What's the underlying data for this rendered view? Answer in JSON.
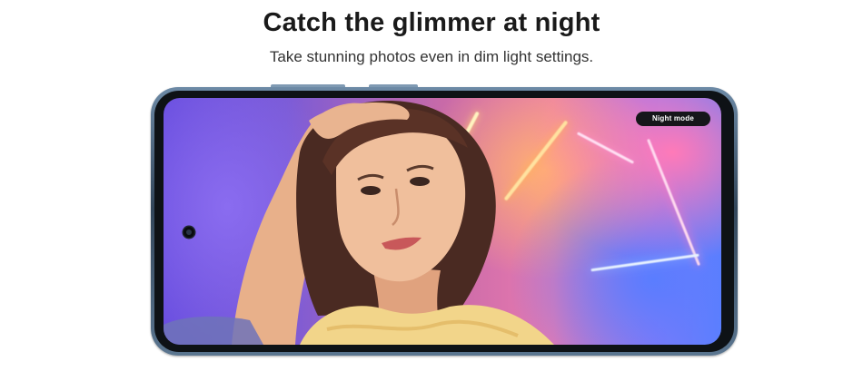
{
  "header": {
    "title": "Catch the glimmer at night",
    "subtitle": "Take stunning photos even in dim light settings."
  },
  "phone": {
    "badge_label": "Night mode",
    "frame_color": "#3a5068",
    "screen_colors": [
      "#6a4fe0",
      "#c86aa8",
      "#e97ab0",
      "#5a80ff"
    ]
  },
  "photo": {
    "subject": "portrait-photo"
  }
}
